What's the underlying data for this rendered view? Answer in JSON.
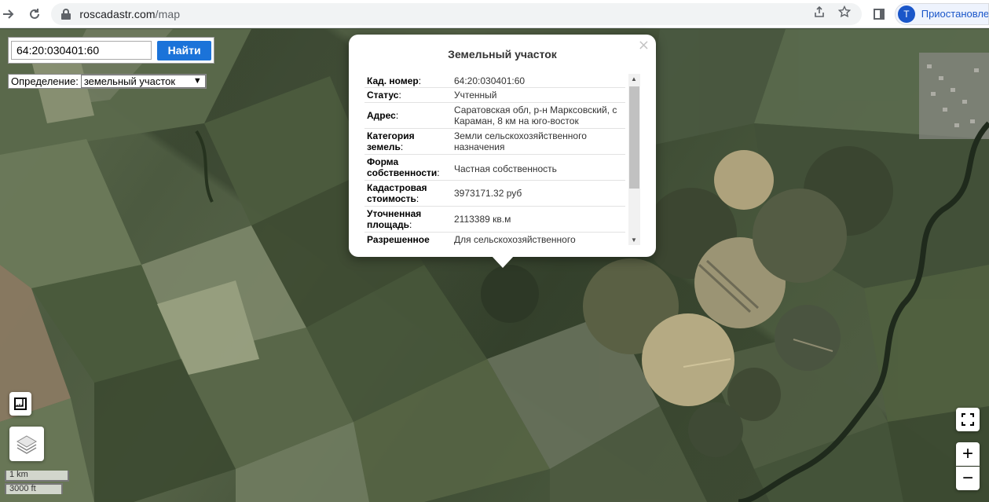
{
  "browser": {
    "url_host": "roscadastr.com",
    "url_path": "/map",
    "profile_initial": "T",
    "profile_label": "Приостановле"
  },
  "search": {
    "value": "64:20:030401:60",
    "button_label": "Найти"
  },
  "definition": {
    "label": "Определение:",
    "selected": "земельный участок"
  },
  "popup": {
    "close": "×",
    "title": "Земельный участок",
    "rows": [
      {
        "key": "Кад. номер",
        "value": "64:20:030401:60"
      },
      {
        "key": "Статус",
        "value": "Учтенный"
      },
      {
        "key": "Адрес",
        "value": "Саратовская обл, р-н Марксовский, с Караман, 8 км на юго-восток"
      },
      {
        "key": "Категория земель",
        "value": "Земли сельскохозяйственного назначения"
      },
      {
        "key": "Форма собственности",
        "value": "Частная собственность"
      },
      {
        "key": "Кадастровая стоимость",
        "value": "3973171.32 руб"
      },
      {
        "key": "Уточненная площадь",
        "value": "2113389 кв.м"
      },
      {
        "key": "Разрешенное",
        "value": "Для сельскохозяйственного"
      }
    ]
  },
  "map_controls": {
    "zoom_in": "+",
    "zoom_out": "−",
    "scale_km": "1 km",
    "scale_ft": "3000 ft"
  },
  "colors": {
    "accent": "#1b73d9",
    "profile": "#1a56c9"
  }
}
